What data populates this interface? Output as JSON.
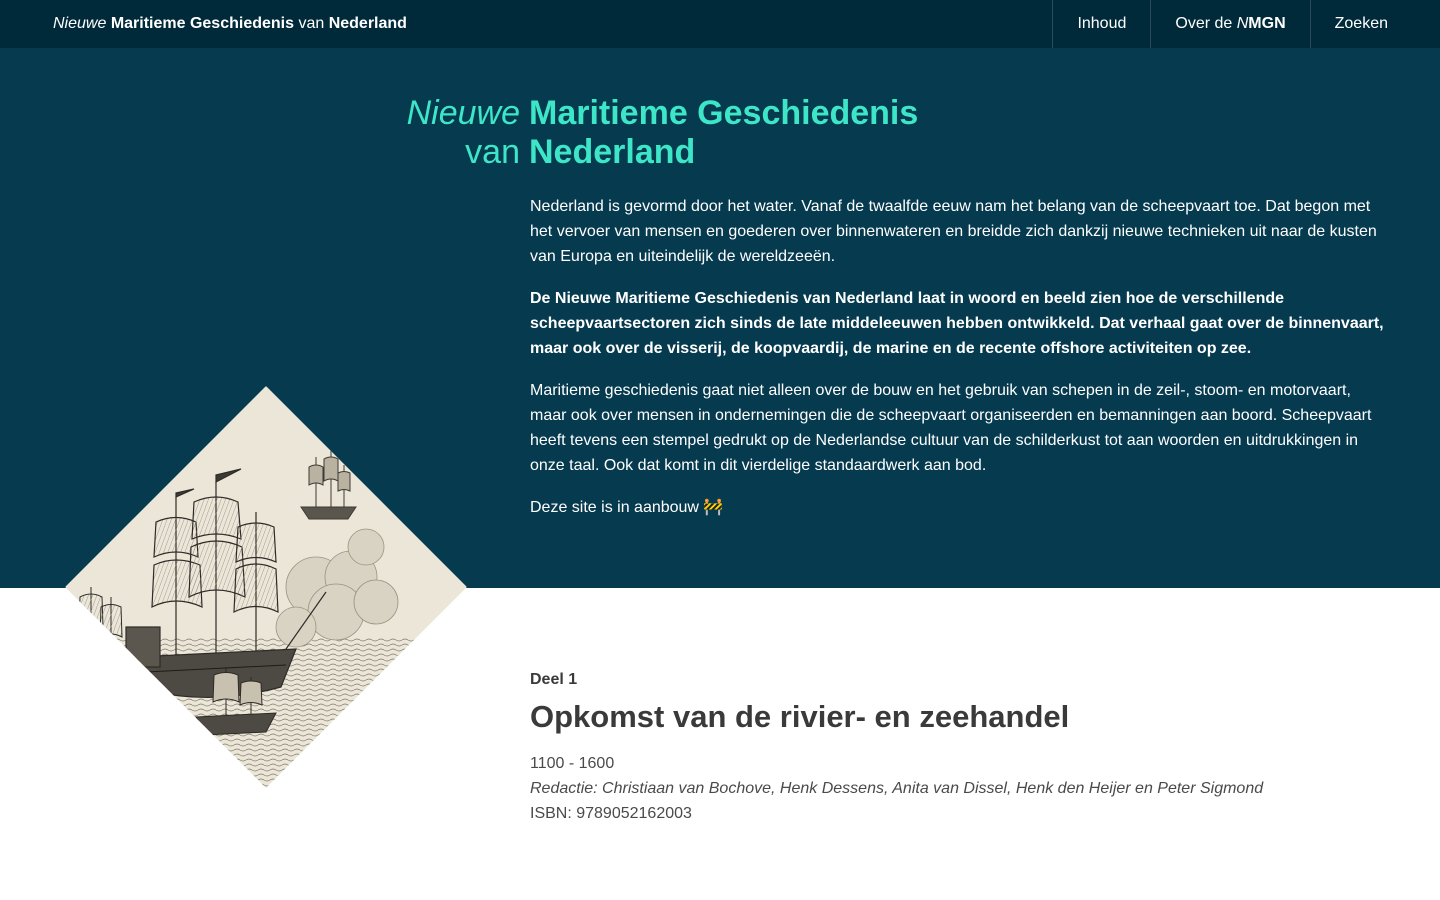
{
  "navbar": {
    "brand": {
      "word1": "Nieuwe",
      "word2": "Maritieme Geschiedenis",
      "word3": "van",
      "word4": "Nederland"
    },
    "items": [
      {
        "label": "Inhoud"
      },
      {
        "label_prefix": "Over de ",
        "label_italic": "N",
        "label_bold": "MGN"
      },
      {
        "label": "Zoeken"
      }
    ]
  },
  "hero": {
    "title": {
      "line1_left": "Nieuwe",
      "line1_right": "Maritieme Geschiedenis",
      "line2_left": "van",
      "line2_right": "Nederland"
    },
    "paragraphs": [
      "Nederland is gevormd door het water. Vanaf de twaalfde eeuw nam het belang van de scheepvaart toe. Dat begon met het vervoer van mensen en goederen over binnenwateren en breidde zich dankzij nieuwe technieken uit naar de kusten van Europa en uiteindelijk de wereldzeeën.",
      "De Nieuwe Maritieme Geschiedenis van Nederland laat in woord en beeld zien hoe de verschillende scheepvaartsectoren zich sinds de late middeleeuwen hebben ontwikkeld. Dat verhaal gaat over de binnenvaart, maar ook over de visserij, de koopvaardij, de marine en de recente offshore activiteiten op zee.",
      "Maritieme geschiedenis gaat niet alleen over de bouw en het gebruik van schepen in de zeil-, stoom- en motorvaart, maar ook over mensen in ondernemingen die de scheepvaart organiseerden en bemanningen aan boord. Scheepvaart heeft tevens een stempel gedrukt op de Nederlandse cultuur van de schilderkust tot aan woorden en uitdrukkingen in onze taal. Ook dat komt in dit vierdelige standaardwerk aan bod.",
      "Deze site is in aanbouw 🚧"
    ]
  },
  "volume": {
    "kicker": "Deel 1",
    "title": "Opkomst van de rivier- en zeehandel",
    "period": "1100 - 1600",
    "editors": "Redactie: Christiaan van Bochove, Henk Dessens, Anita van Dissel, Henk den Heijer en Peter Sigmond",
    "isbn": "ISBN: 9789052162003"
  },
  "colors": {
    "navbar_bg": "#002a3a",
    "hero_bg": "#063a4f",
    "accent": "#3ee6c8",
    "text_dark": "#3a3a3a"
  }
}
